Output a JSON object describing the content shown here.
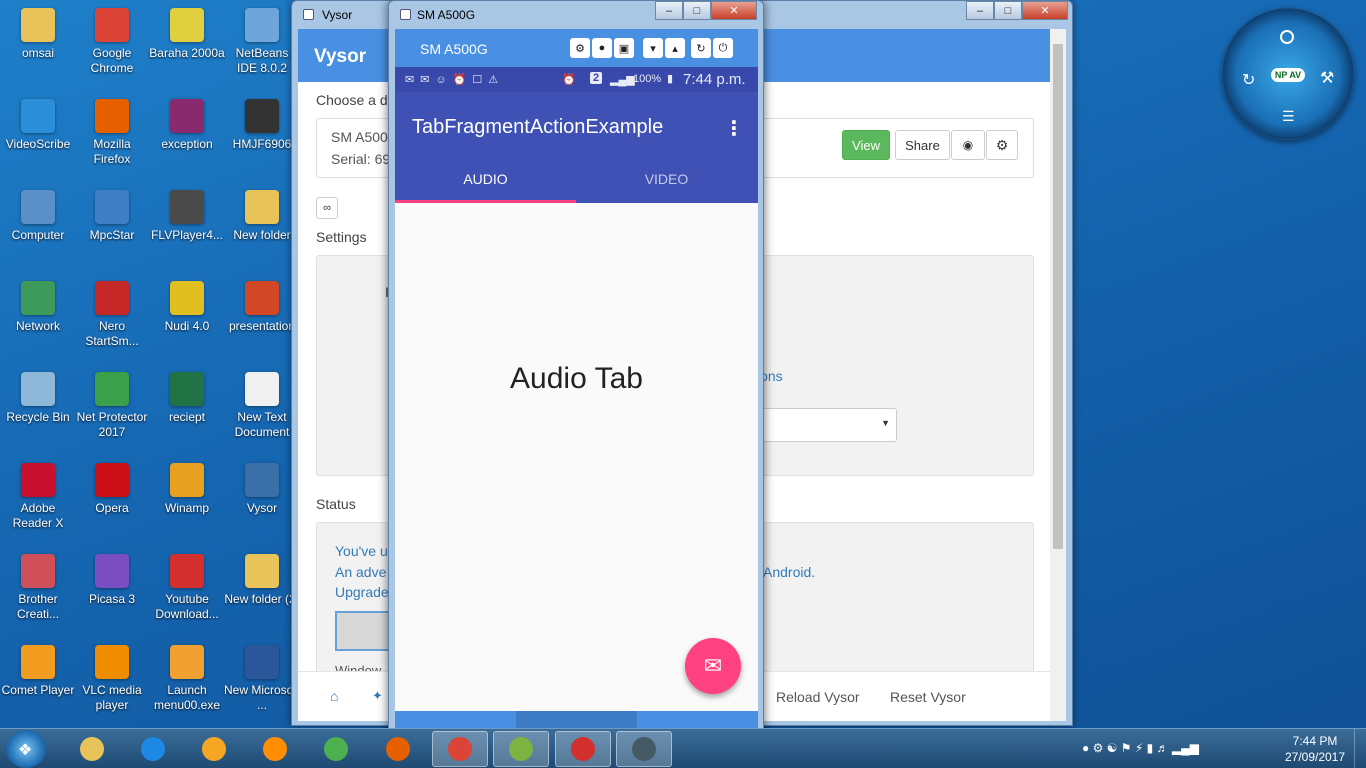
{
  "desktop_icons": [
    {
      "label": "omsai",
      "icon": "folder-icon",
      "color": "#e8c35a"
    },
    {
      "label": "Google Chrome",
      "icon": "chrome-icon",
      "color": "#db4437"
    },
    {
      "label": "Baraha 2000a",
      "icon": "baraha-icon",
      "color": "#e0d040"
    },
    {
      "label": "NetBeans IDE 8.0.2",
      "icon": "netbeans-icon",
      "color": "#6fa6d9"
    },
    {
      "label": "VideoScribe",
      "icon": "videoscribe-icon",
      "color": "#2a8fd8"
    },
    {
      "label": "Mozilla Firefox",
      "icon": "firefox-icon",
      "color": "#e66000"
    },
    {
      "label": "exception",
      "icon": "winrar-icon",
      "color": "#8a2a6e"
    },
    {
      "label": "HMJF6906",
      "icon": "hmjf-icon",
      "color": "#333333"
    },
    {
      "label": "Computer",
      "icon": "computer-icon",
      "color": "#5b8fc7"
    },
    {
      "label": "MpcStar",
      "icon": "mpcstar-icon",
      "color": "#3d7ec4"
    },
    {
      "label": "FLVPlayer4...",
      "icon": "flvplayer-icon",
      "color": "#4a4a4a"
    },
    {
      "label": "New folder",
      "icon": "folder-icon",
      "color": "#e8c35a"
    },
    {
      "label": "Network",
      "icon": "network-icon",
      "color": "#3d9a5a"
    },
    {
      "label": "Nero StartSm...",
      "icon": "nero-icon",
      "color": "#c62828"
    },
    {
      "label": "Nudi 4.0",
      "icon": "nudi-icon",
      "color": "#e0c020"
    },
    {
      "label": "presentation",
      "icon": "powerpoint-icon",
      "color": "#d24726"
    },
    {
      "label": "Recycle Bin",
      "icon": "recycle-bin-icon",
      "color": "#8fb8d8"
    },
    {
      "label": "Net Protector 2017",
      "icon": "netprotector-icon",
      "color": "#3aa14a"
    },
    {
      "label": "reciept",
      "icon": "excel-icon",
      "color": "#217346"
    },
    {
      "label": "New Text Document",
      "icon": "text-document-icon",
      "color": "#f0f0f0"
    },
    {
      "label": "Adobe Reader X",
      "icon": "adobe-reader-icon",
      "color": "#c8102e"
    },
    {
      "label": "Opera",
      "icon": "opera-icon",
      "color": "#cc0f16"
    },
    {
      "label": "Winamp",
      "icon": "winamp-icon",
      "color": "#e8a020"
    },
    {
      "label": "Vysor",
      "icon": "vysor-icon",
      "color": "#3a6fa8"
    },
    {
      "label": "Brother Creati...",
      "icon": "brother-icon",
      "color": "#d0505a"
    },
    {
      "label": "Picasa 3",
      "icon": "picasa-icon",
      "color": "#7a4ec0"
    },
    {
      "label": "Youtube Download...",
      "icon": "youtube-downloader-icon",
      "color": "#d32f2f"
    },
    {
      "label": "New folder (2)",
      "icon": "folder-icon",
      "color": "#e8c35a"
    },
    {
      "label": "Comet Player",
      "icon": "comet-player-icon",
      "color": "#f29d1f"
    },
    {
      "label": "VLC media player",
      "icon": "vlc-icon",
      "color": "#f08c00"
    },
    {
      "label": "Launch menu00.exe",
      "icon": "launch-icon",
      "color": "#f0a030"
    },
    {
      "label": "New Microsoft ...",
      "icon": "word-icon",
      "color": "#2b579a"
    }
  ],
  "vysor": {
    "window_title": "Vysor",
    "header_title": "Vysor",
    "choose_label": "Choose a d",
    "device_name": "SM A500",
    "device_serial": "Serial: 69",
    "view_label": "View",
    "share_label": "Share",
    "settings_label": "Settings",
    "settings_fragment_left": "I",
    "settings_link_fragment": "ions",
    "status_label": "Status",
    "status_line1": "You've u",
    "status_line2": "An adve",
    "status_line2_end": "Android.",
    "status_line3": "Upgrade",
    "status_line4": "Window",
    "reload_label": "Reload Vysor",
    "reset_label": "Reset Vysor"
  },
  "phone": {
    "window_title": "SM A500G",
    "toolbar_name": "SM A500G",
    "battery": "100%",
    "time": "7:44 p.m.",
    "notification_count": "2",
    "app_title": "TabFragmentActionExample",
    "tabs": [
      {
        "label": "AUDIO",
        "active": true
      },
      {
        "label": "VIDEO",
        "active": false
      }
    ],
    "content_text": "Audio Tab",
    "accent_color": "#ff4081",
    "primary_color": "#3f51b5"
  },
  "npav": {
    "badge": "NP AV"
  },
  "taskbar": {
    "time": "7:44 PM",
    "date": "27/09/2017",
    "items": [
      "explorer-icon",
      "ie-icon",
      "star-icon",
      "media-icon",
      "gmail-icon",
      "firefox-icon",
      "chrome-icon",
      "android-studio-icon",
      "youtube-downloader-icon",
      "vysor-icon"
    ]
  }
}
